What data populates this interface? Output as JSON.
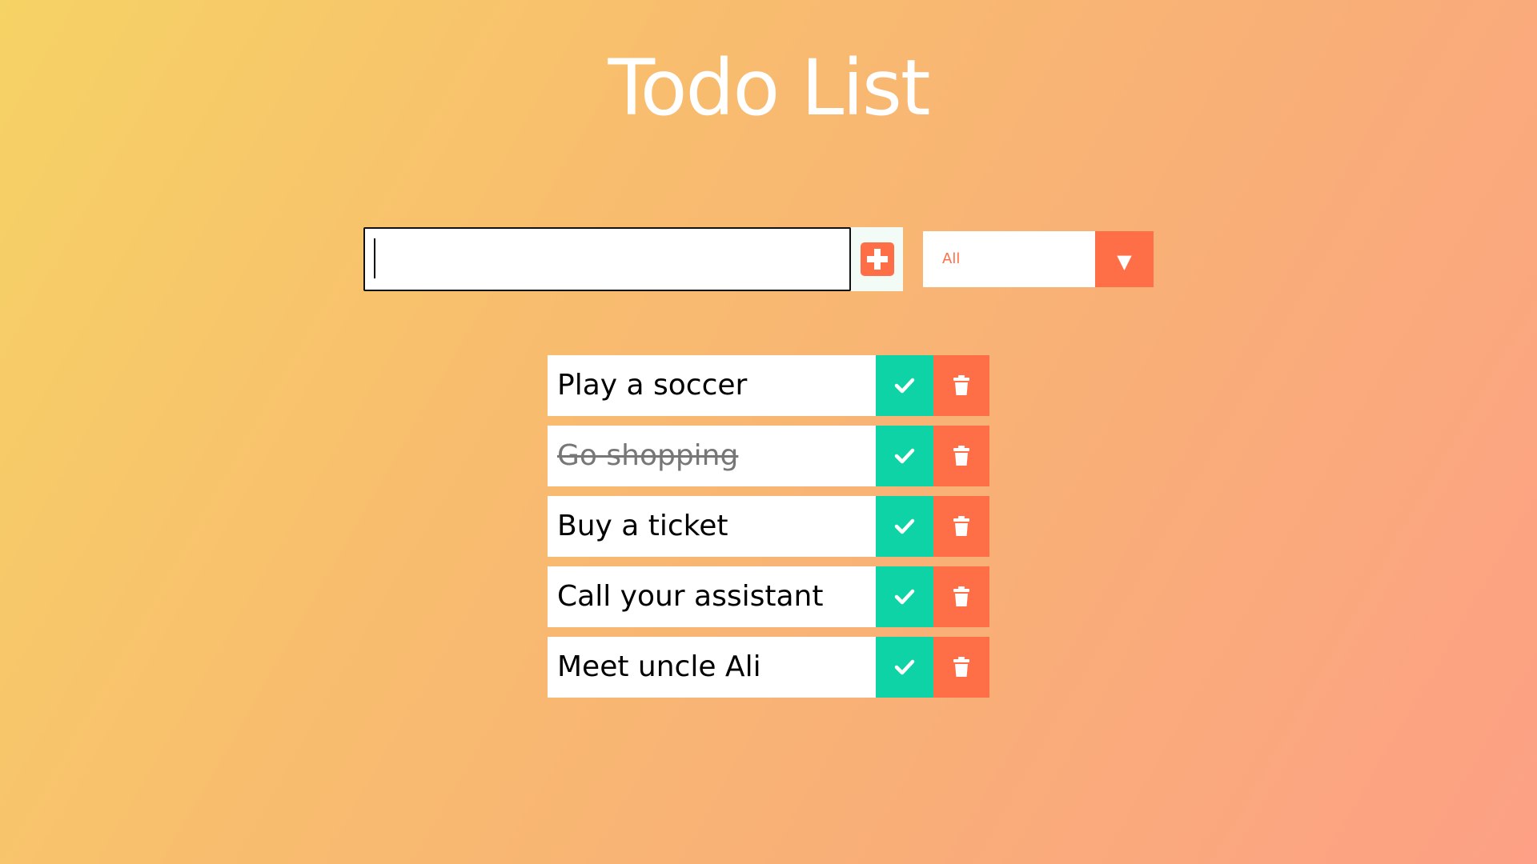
{
  "header": {
    "title": "Todo List"
  },
  "input": {
    "value": "",
    "placeholder": ""
  },
  "filter": {
    "selected": "All",
    "arrow": "▼"
  },
  "todos": [
    {
      "text": "Play a soccer",
      "completed": false
    },
    {
      "text": "Go shopping",
      "completed": true
    },
    {
      "text": "Buy a ticket",
      "completed": false
    },
    {
      "text": "Call your assistant",
      "completed": false
    },
    {
      "text": "Meet uncle Ali",
      "completed": false
    }
  ],
  "icons": {
    "add": "plus-square-icon",
    "complete": "check-icon",
    "delete": "trash-icon",
    "dropdown": "caret-down-icon"
  },
  "colors": {
    "accent": "#ff6f47",
    "complete": "#0dd3a6",
    "gradient_start": "#f6d365",
    "gradient_end": "#fda085",
    "title": "#ffffff"
  }
}
